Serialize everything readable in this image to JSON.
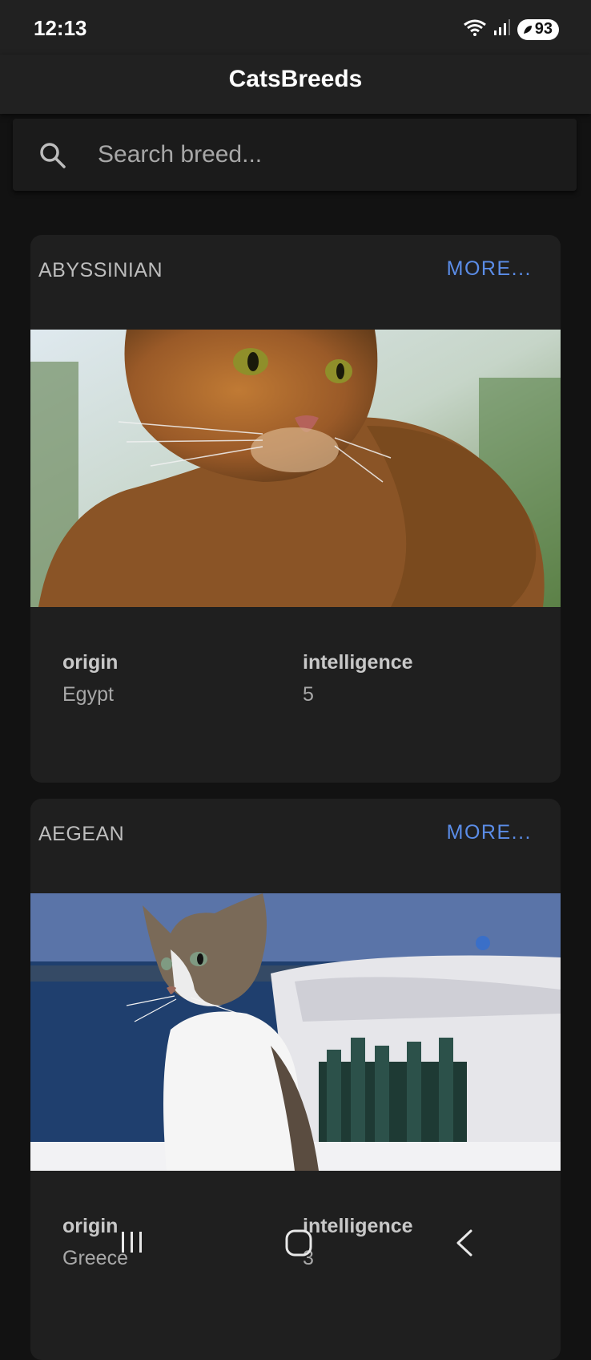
{
  "status_bar": {
    "time": "12:13",
    "battery": "93",
    "icons": [
      "wifi-icon",
      "signal-icon",
      "battery-icon"
    ]
  },
  "app": {
    "title": "CatsBreeds"
  },
  "search": {
    "placeholder": "Search breed...",
    "value": ""
  },
  "breeds": [
    {
      "name": "ABYSSINIAN",
      "more_label": "MORE...",
      "origin_label": "origin",
      "origin": "Egypt",
      "intelligence_label": "intelligence",
      "intelligence": "5"
    },
    {
      "name": "AEGEAN",
      "more_label": "MORE...",
      "origin_label": "origin",
      "origin": "Greece",
      "intelligence_label": "intelligence",
      "intelligence": "3"
    }
  ],
  "nav": {
    "icons": [
      "recent-apps-icon",
      "home-icon",
      "back-icon"
    ]
  },
  "colors": {
    "accent": "#5b8de8",
    "surface": "#1f1f1f",
    "background": "#121212"
  }
}
